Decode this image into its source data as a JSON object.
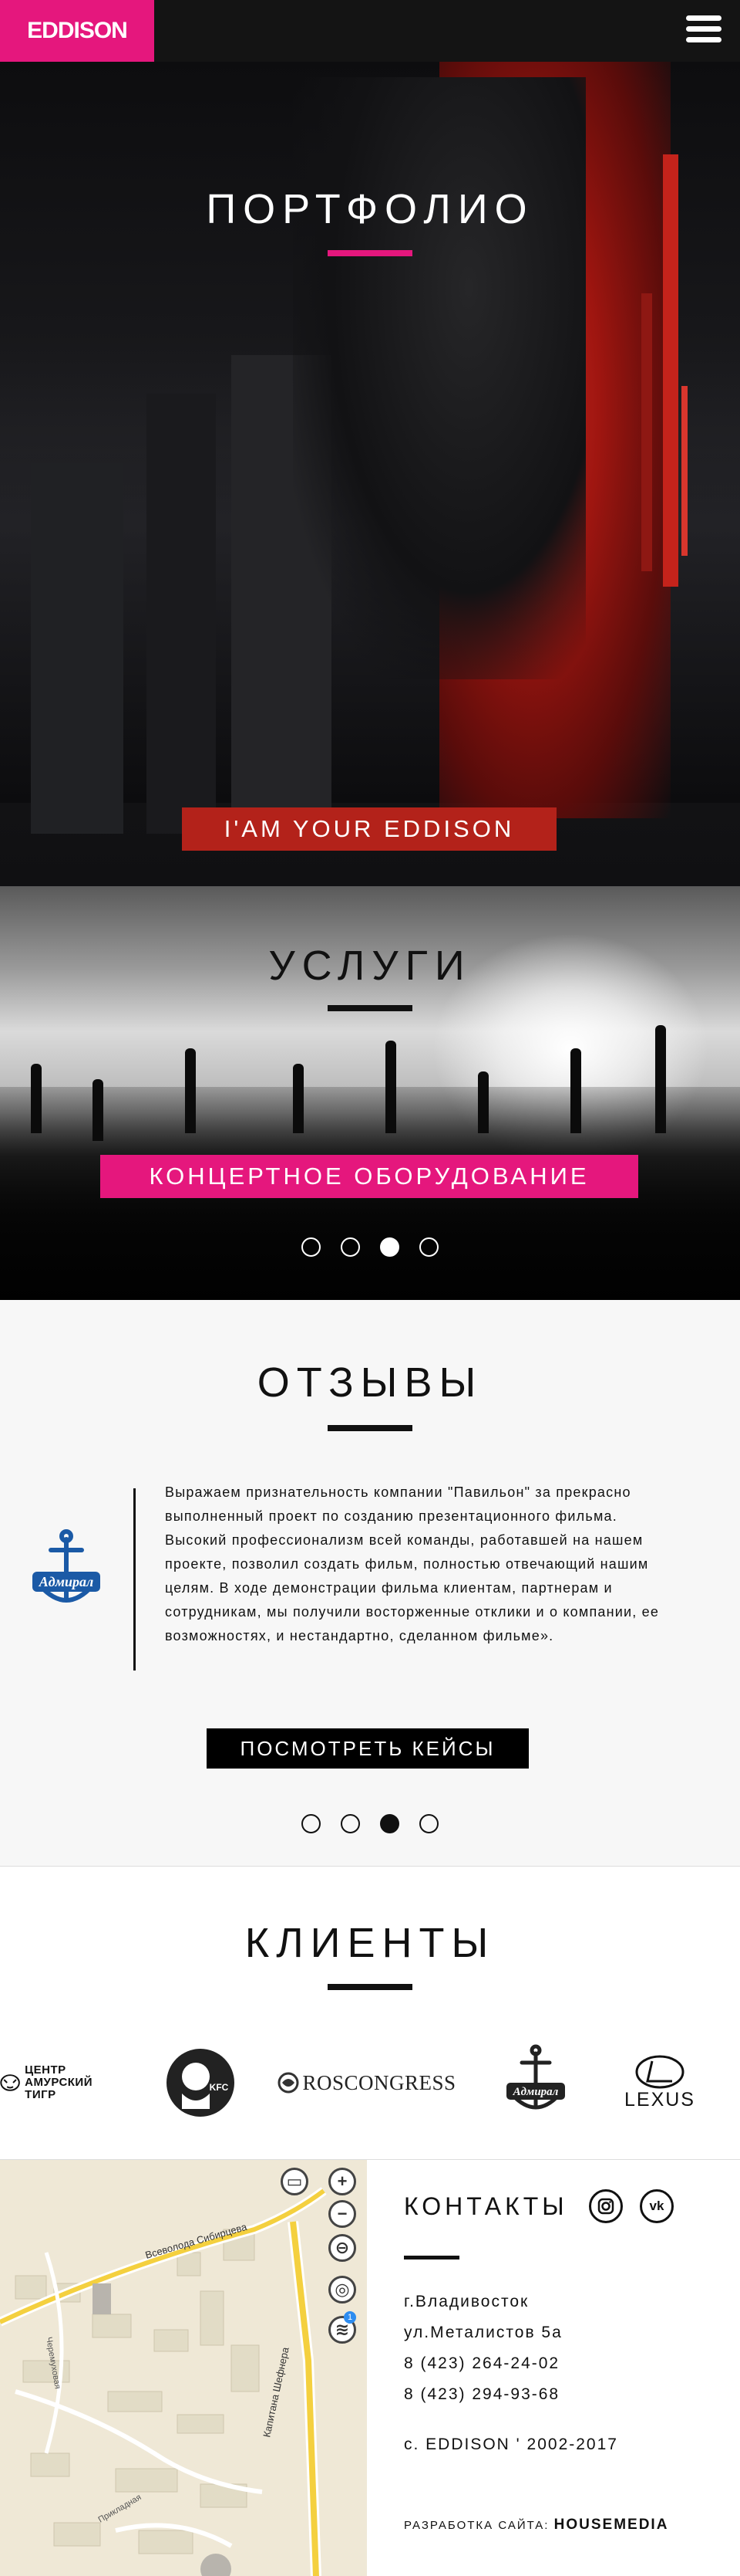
{
  "header": {
    "logo": "EDDISON",
    "menu_icon": "menu-icon"
  },
  "portfolio": {
    "title": "ПОРТФОЛИО",
    "banner": "I'AM YOUR EDDISON",
    "slides": 4,
    "active_slide": 3
  },
  "services": {
    "title": "УСЛУГИ",
    "banner": "КОНЦЕРТНОЕ ОБОРУДОВАНИЕ",
    "slides": 4,
    "active_slide": 3
  },
  "reviews": {
    "title": "ОТЗЫВЫ",
    "logo_text": "Адмирал",
    "text": "Выражаем признательность компании \"Павильон\" за прекрасно выполненный проект по созданию презентационного фильма. Высокий профессионализм всей команды, работавшей на нашем проекте, позволил создать фильм, полностью отвечающий нашим целям. В ходе демонстрации фильма клиентам, партнерам и сотрудникам, мы получили восторженные отклики и о компании, ее возможностях, и нестандартно, сделанном фильме».",
    "button": "ПОСМОТРЕТЬ КЕЙСЫ",
    "slides": 4,
    "active_slide": 3
  },
  "clients": {
    "title": "КЛИЕНТЫ",
    "amur_tiger": {
      "line1": "ЦЕНТР",
      "line2": "АМУРСКИЙ",
      "line3": "ТИГР"
    },
    "kfc": "KFC",
    "roscongress": "ROSCONGRESS",
    "admiral": "Адмирал",
    "lexus": "LEXUS"
  },
  "map": {
    "street": "Всеволода Сибирцева",
    "street2": "Капитана Шефнера",
    "street3": "Прикладная",
    "street4": "Черемуховая",
    "zoom_in": "+",
    "zoom_out": "−",
    "traffic_badge": "1"
  },
  "contacts": {
    "title": "КОНТАКТЫ",
    "city": "г.Владивосток",
    "address": "ул.Металистов 5а",
    "phone1": "8 (423) 264-24-02",
    "phone2": "8 (423) 294-93-68",
    "copyright": "с. EDDISON ' 2002-2017",
    "dev_label": "РАЗРАБОТКА САЙТА:",
    "dev_name": "HOUSEMEDIA",
    "instagram": "instagram-icon",
    "vk": "vk-icon",
    "vk_label": "vk"
  },
  "colors": {
    "brand_pink": "#e5177d",
    "hero_red": "#b3221a",
    "dark": "#141414"
  }
}
